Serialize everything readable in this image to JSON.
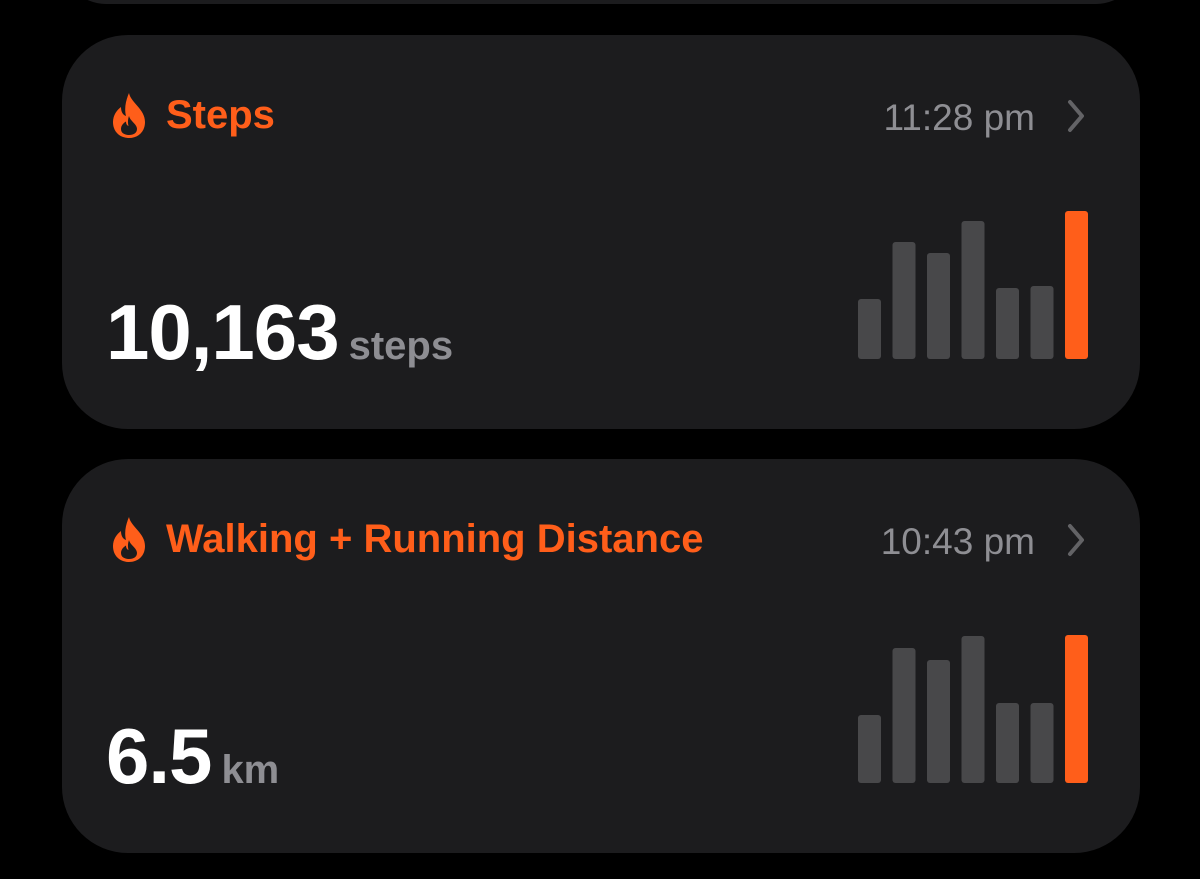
{
  "colors": {
    "accent": "#ff5e1a",
    "bar_inactive": "#48484a",
    "card_bg": "#1c1c1e",
    "secondary_text": "#8e8e93"
  },
  "cards": [
    {
      "icon": "flame-icon",
      "title": "Steps",
      "time": "11:28 pm",
      "value": "10,163",
      "unit": "steps",
      "chart_data": {
        "type": "bar",
        "values": [
          60,
          117,
          106,
          138,
          71,
          73,
          148
        ],
        "highlight_index": 6,
        "max": 148
      }
    },
    {
      "icon": "flame-icon",
      "title": "Walking + Running Distance",
      "time": "10:43 pm",
      "value": "6.5",
      "unit": "km",
      "chart_data": {
        "type": "bar",
        "values": [
          68,
          135,
          123,
          147,
          80,
          80,
          148
        ],
        "highlight_index": 6,
        "max": 148
      }
    }
  ]
}
